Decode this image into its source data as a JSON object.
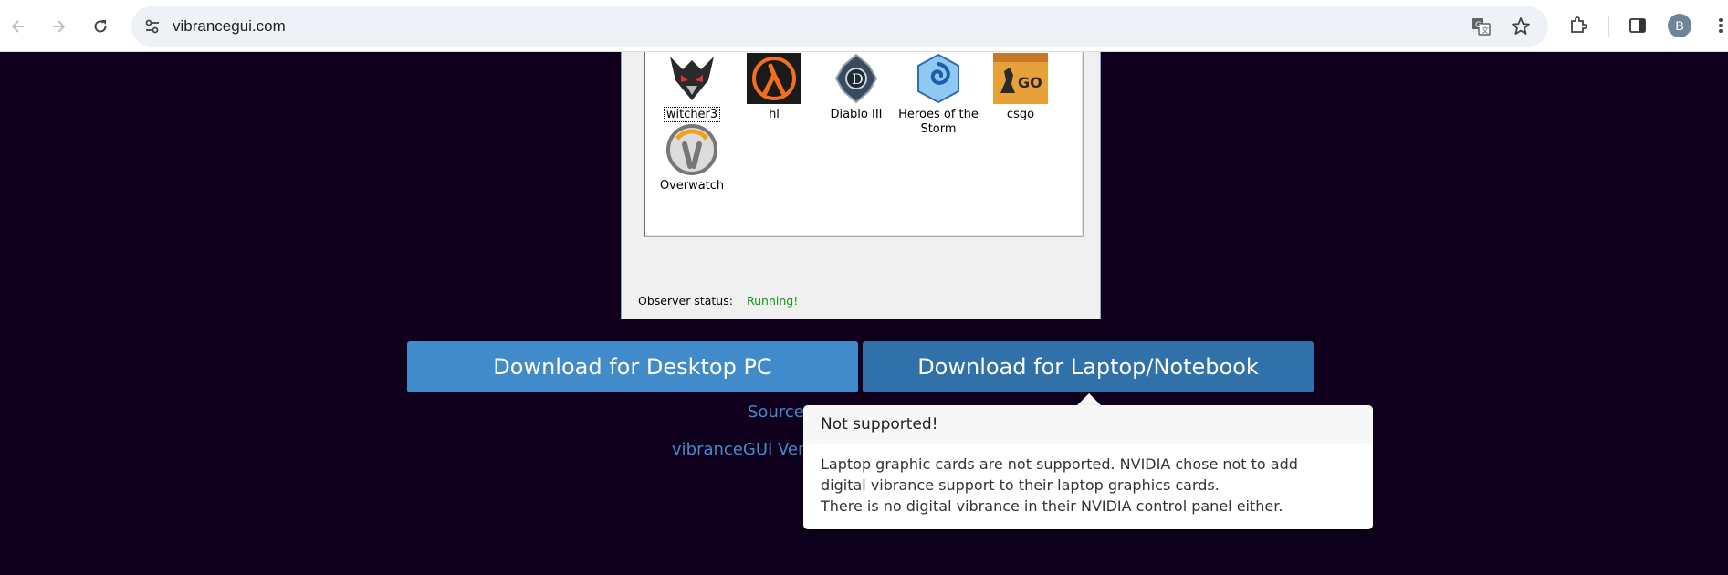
{
  "browser": {
    "url": "vibrancegui.com",
    "avatar_initial": "B",
    "accent": "#428bca"
  },
  "app_window": {
    "games": [
      {
        "label": "witcher3",
        "icon": "witcher3-icon",
        "selected": true
      },
      {
        "label": "hl",
        "icon": "half-life-icon"
      },
      {
        "label": "Diablo III",
        "icon": "diablo3-icon"
      },
      {
        "label": "Heroes of the Storm",
        "icon": "heroes-of-the-storm-icon"
      },
      {
        "label": "csgo",
        "icon": "csgo-icon"
      },
      {
        "label": "Overwatch",
        "icon": "overwatch-icon"
      }
    ],
    "observer_status_label": "Observer status:",
    "observer_status_value": "Running!"
  },
  "downloads": {
    "desktop_label": "Download for Desktop PC",
    "laptop_label": "Download for Laptop/Notebook"
  },
  "links": {
    "source_partial": "Source",
    "version_partial": "vibranceGUI Ver"
  },
  "popover": {
    "title": "Not supported!",
    "body_lines": [
      "Laptop graphic cards are not supported. NVIDIA chose not to add",
      "digital vibrance support to their laptop graphics cards.",
      "There is no digital vibrance in their NVIDIA control panel either."
    ]
  }
}
